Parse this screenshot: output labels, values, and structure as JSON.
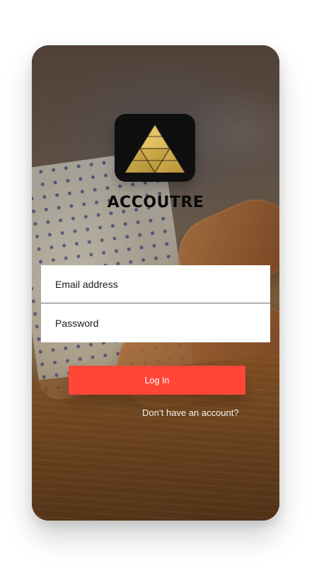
{
  "app": {
    "brand_name": "ACCOUTRE",
    "logo": {
      "icon_name": "triangle-logo-icon",
      "colors": {
        "background": "#0f0f0f",
        "gold_light": "#f3d26a",
        "gold_mid": "#d6b14b",
        "gold_dark": "#b38b2c"
      }
    }
  },
  "login": {
    "email_placeholder": "Email address",
    "password_placeholder": "Password",
    "login_button_label": "Log In",
    "signup_prompt": "Don’t have an account?"
  },
  "theme": {
    "accent": "#ff4637"
  }
}
